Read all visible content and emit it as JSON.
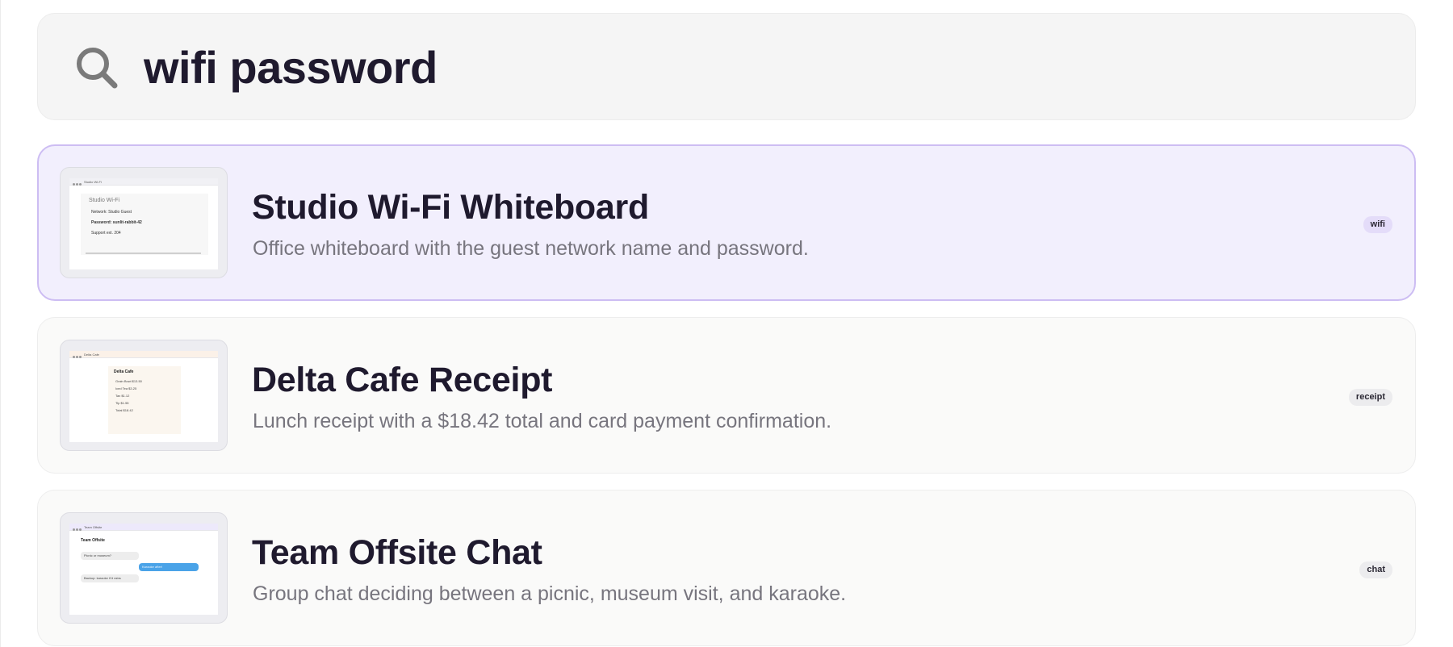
{
  "search": {
    "query": "wifi password",
    "icon": "search-icon"
  },
  "results": [
    {
      "title": "Studio Wi-Fi Whiteboard",
      "description": "Office whiteboard with the guest network name and password.",
      "tag": "wifi",
      "selected": true,
      "thumbnail": {
        "window_title": "Studio Wi-Fi",
        "heading": "Studio Wi-Fi",
        "lines": [
          "Network: Studio Guest",
          "Password: sunlit-rabbit-42",
          "Support ext. 204"
        ]
      }
    },
    {
      "title": "Delta Cafe Receipt",
      "description": "Lunch receipt with a $18.42 total and card payment confirmation.",
      "tag": "receipt",
      "selected": false,
      "thumbnail": {
        "window_title": "Delta Cafe",
        "heading": "Delta Cafe",
        "lines": [
          "Grain Bowl $13.50",
          "Iced Tea $3.25",
          "Tax $1.12",
          "Tip $1.55",
          "Total $18.42"
        ]
      }
    },
    {
      "title": "Team Offsite Chat",
      "description": "Group chat deciding between a picnic, museum visit, and karaoke.",
      "tag": "chat",
      "selected": false,
      "thumbnail": {
        "window_title": "Team Offsite",
        "heading": "Team Offsite",
        "messages": [
          "Picnic or museum?",
          "Karaoke after!",
          "Backup: karaoke if it rains"
        ]
      }
    }
  ],
  "colors": {
    "selected_background": "#f2effd",
    "selected_border": "#cdbdf3",
    "chat_bubble_out": "#4aa3e8"
  }
}
